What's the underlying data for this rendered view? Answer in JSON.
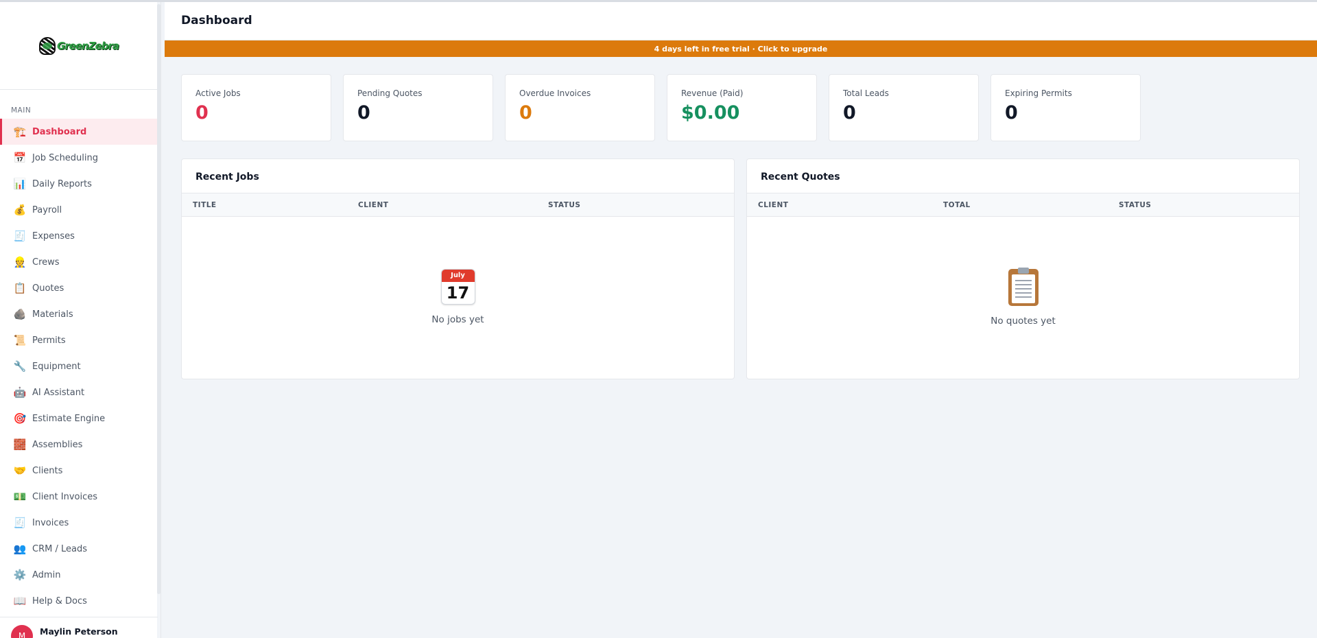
{
  "app": {
    "brand": "GreenZebra"
  },
  "header": {
    "title": "Dashboard"
  },
  "banner": {
    "text": "4 days left in free trial · Click to upgrade"
  },
  "sidebar": {
    "section": "MAIN",
    "items": [
      {
        "label": "Dashboard",
        "icon": "🏗️",
        "active": true
      },
      {
        "label": "Job Scheduling",
        "icon": "📅"
      },
      {
        "label": "Daily Reports",
        "icon": "📊"
      },
      {
        "label": "Payroll",
        "icon": "💰"
      },
      {
        "label": "Expenses",
        "icon": "🧾"
      },
      {
        "label": "Crews",
        "icon": "👷"
      },
      {
        "label": "Quotes",
        "icon": "📋"
      },
      {
        "label": "Materials",
        "icon": "🪨"
      },
      {
        "label": "Permits",
        "icon": "📜"
      },
      {
        "label": "Equipment",
        "icon": "🔧"
      },
      {
        "label": "AI Assistant",
        "icon": "🤖"
      },
      {
        "label": "Estimate Engine",
        "icon": "🎯"
      },
      {
        "label": "Assemblies",
        "icon": "🧱"
      },
      {
        "label": "Clients",
        "icon": "🤝"
      },
      {
        "label": "Client Invoices",
        "icon": "💵"
      },
      {
        "label": "Invoices",
        "icon": "🧾"
      },
      {
        "label": "CRM / Leads",
        "icon": "👥"
      },
      {
        "label": "Admin",
        "icon": "⚙️"
      },
      {
        "label": "Help & Docs",
        "icon": "📖"
      }
    ],
    "user": {
      "initial": "M",
      "name": "Maylin Peterson"
    }
  },
  "stats": [
    {
      "label": "Active Jobs",
      "value": "0",
      "color": "#e0314f"
    },
    {
      "label": "Pending Quotes",
      "value": "0",
      "color": "#111827"
    },
    {
      "label": "Overdue Invoices",
      "value": "0",
      "color": "#dc7a0c"
    },
    {
      "label": "Revenue (Paid)",
      "value": "$0.00",
      "color": "#16905f"
    },
    {
      "label": "Total Leads",
      "value": "0",
      "color": "#111827"
    },
    {
      "label": "Expiring Permits",
      "value": "0",
      "color": "#111827"
    }
  ],
  "recent_jobs": {
    "title": "Recent Jobs",
    "columns": [
      "TITLE",
      "CLIENT",
      "STATUS"
    ],
    "empty_icon": {
      "month": "July",
      "day": "17"
    },
    "empty_text": "No jobs yet"
  },
  "recent_quotes": {
    "title": "Recent Quotes",
    "columns": [
      "CLIENT",
      "TOTAL",
      "STATUS"
    ],
    "empty_text": "No quotes yet"
  },
  "colors": {
    "accent": "#e0314f",
    "banner": "#dc7a0c",
    "revenue": "#16905f"
  }
}
